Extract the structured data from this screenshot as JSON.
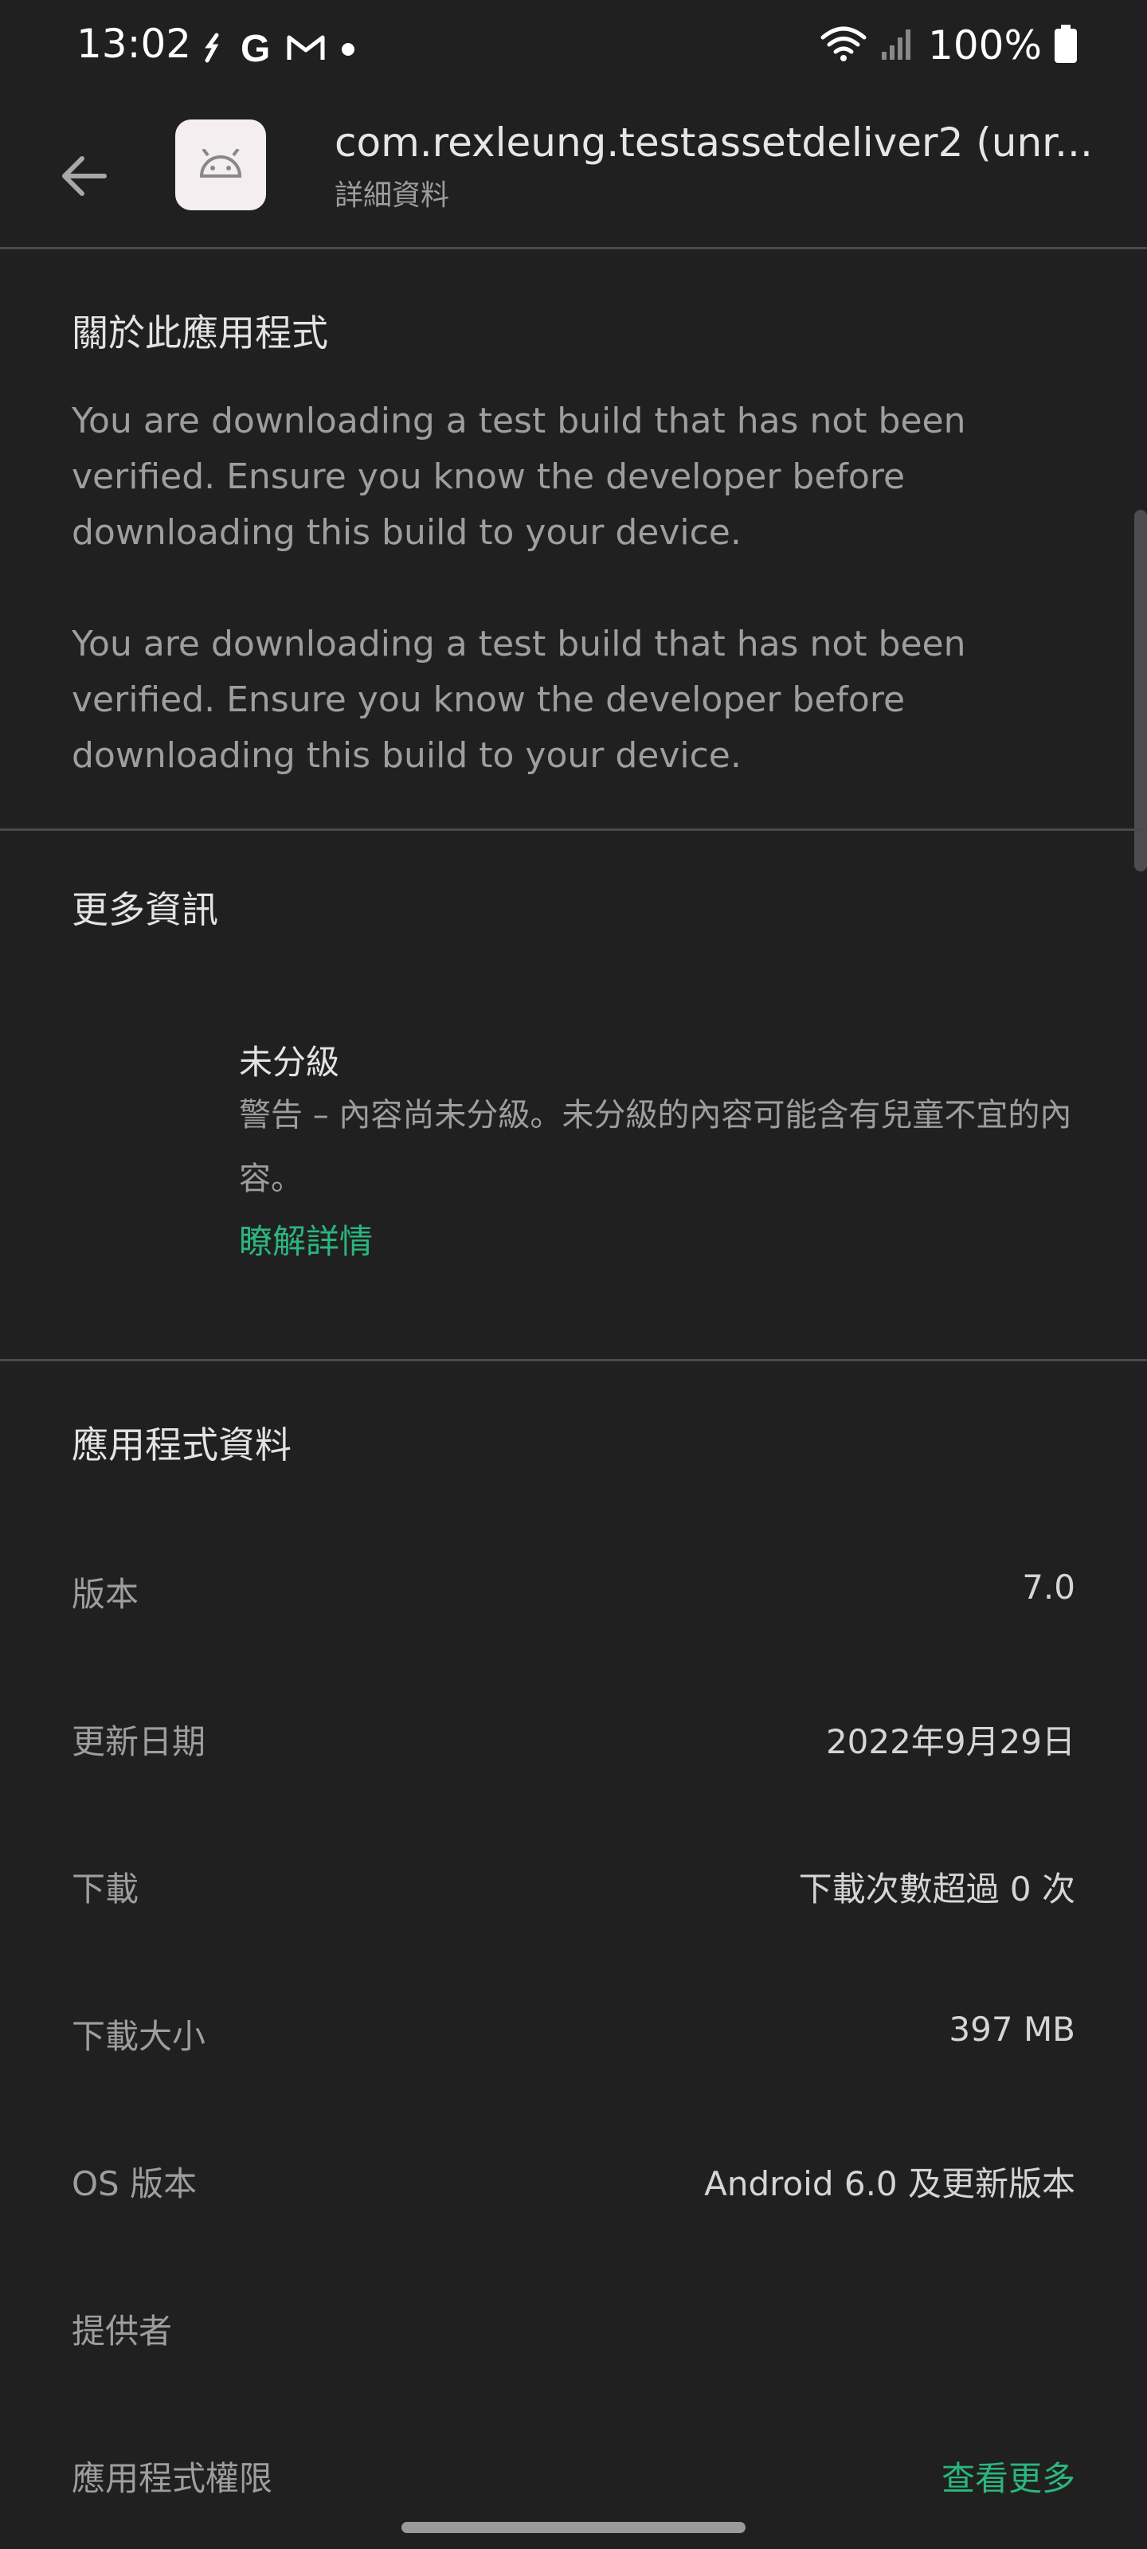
{
  "status_bar": {
    "time": "13:02",
    "g_icon": "G",
    "battery_text": "100%",
    "icons": [
      "sync-icon",
      "google-icon",
      "gmail-icon",
      "notification-dot-icon",
      "wifi-icon",
      "signal-icon",
      "battery-icon"
    ]
  },
  "app_bar": {
    "title": "com.rexleung.testassetdeliver2 (unr...",
    "subtitle": "詳細資料",
    "back_icon": "arrow-back-icon",
    "app_icon": "android-icon"
  },
  "about": {
    "heading": "關於此應用程式",
    "paragraph1": "You are downloading a test build that has not been verified. Ensure you know the developer before downloading this build to your device.",
    "paragraph2": "You are downloading a test build that has not been verified. Ensure you know the developer before downloading this build to your device."
  },
  "more_info": {
    "heading": "更多資訊",
    "rating_title": "未分級",
    "rating_desc": "警告 – 內容尚未分級。未分級的內容可能含有兒童不宜的內容。",
    "learn_more": "瞭解詳情"
  },
  "app_info": {
    "heading": "應用程式資料",
    "rows": [
      {
        "label": "版本",
        "value": "7.0"
      },
      {
        "label": "更新日期",
        "value": "2022年9月29日"
      },
      {
        "label": "下載",
        "value": "下載次數超過 0 次"
      },
      {
        "label": "下載大小",
        "value": "397 MB"
      },
      {
        "label": "OS 版本",
        "value": "Android 6.0 及更新版本"
      },
      {
        "label": "提供者",
        "value": ""
      },
      {
        "label": "應用程式權限",
        "value": "查看更多"
      }
    ]
  },
  "colors": {
    "background": "#202020",
    "accent": "#2ab67f"
  }
}
